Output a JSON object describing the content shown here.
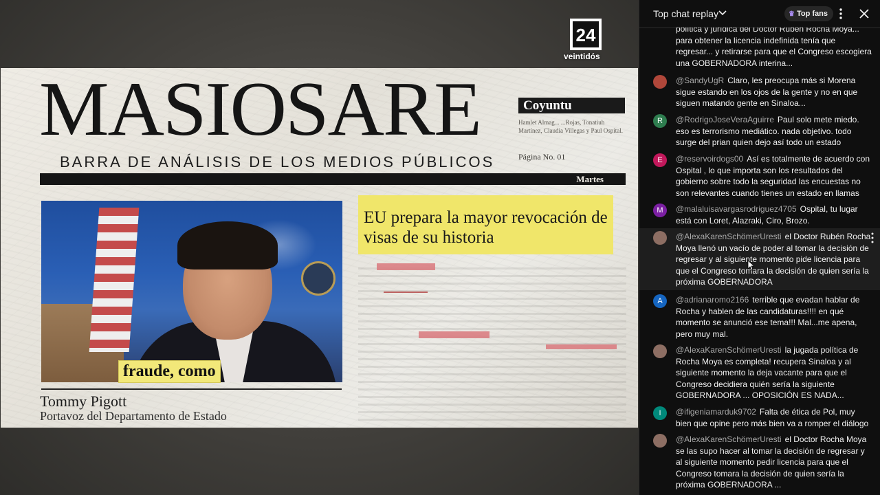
{
  "video": {
    "masthead": "MASIOSARE",
    "subhead": "BARRA DE ANÁLISIS DE LOS MEDIOS PÚBLICOS",
    "section": "Coyuntu",
    "authors": "Hamlet Almag... ...Rojas, Tonatiuh Martínez, Claudia Villegas y Paul Ospital.",
    "page_label": "Página No. 01",
    "day": "Martes",
    "headline": "EU prepara la mayor revocación de visas de su historia",
    "caption": "fraude, como",
    "person_name": "Tommy Pigott",
    "person_role": "Portavoz del Departamento de Estado",
    "brand_number": "24",
    "brand_name": "veintidós"
  },
  "chat": {
    "title": "Top chat replay",
    "top_fans_label": "Top fans",
    "messages": [
      {
        "author": "",
        "text": "política y jurídica del Doctor Rubén Rocha Moya... para obtener la licencia indefinida tenía que regresar... y retirarse para que el Congreso escogiera una GOBERNADORA interina...",
        "avatar_letter": "",
        "avatar_color": ""
      },
      {
        "author": "@SandyUgR",
        "text": "Claro, les preocupa más si Morena sigue estando en los ojos de la gente y no en que siguen matando gente en Sinaloa...",
        "avatar_letter": "",
        "avatar_color": "#b0473a"
      },
      {
        "author": "@RodrigoJoseVeraAguirre",
        "text": "Paul solo mete miedo. eso es terrorismo mediático. nada objetivo. todo surge del prian quien dejo así todo un estado",
        "avatar_letter": "R",
        "avatar_color": "#2e7d4f"
      },
      {
        "author": "@reservoirdogs00",
        "text": "Así es totalmente de acuerdo con Ospital , lo que importa son los resultados del gobierno sobre todo la seguridad las encuestas no son relevantes cuando tienes un estado en llamas",
        "avatar_letter": "E",
        "avatar_color": "#c2185b"
      },
      {
        "author": "@malaluisavargasrodriguez4705",
        "text": "Ospital, tu lugar está con Loret, Alazraki, Ciro, Brozo.",
        "avatar_letter": "M",
        "avatar_color": "#7b1fa2"
      },
      {
        "author": "@AlexaKarenSchömerUresti",
        "text": "el Doctor Rubén Rocha Moya llenó un vacío de poder al tomar la decisión de regresar y al siguiente momento pide licencia para que el Congreso tomara la decisión de quien sería la próxima GOBERNADORA",
        "avatar_letter": "",
        "avatar_color": "#8d6e63"
      },
      {
        "author": "@adrianaromo2166",
        "text": "terrible que evadan hablar de Rocha y hablen de las candidaturas!!!! en qué momento se anunció ese tema!!! Mal...me apena, pero muy mal.",
        "avatar_letter": "A",
        "avatar_color": "#1565c0"
      },
      {
        "author": "@AlexaKarenSchömerUresti",
        "text": "la jugada política de Rocha Moya es completa! recupera Sinaloa y al siguiente momento la deja vacante para que el Congreso decidiera quién sería la siguiente GOBERNADORA ... OPOSICIÓN ES NADA...",
        "avatar_letter": "",
        "avatar_color": "#8d6e63"
      },
      {
        "author": "@ifigeniamarduk9702",
        "text": "Falta de ética de Pol, muy bien que opine pero más bien va a romper el diálogo",
        "avatar_letter": "I",
        "avatar_color": "#00897b"
      },
      {
        "author": "@AlexaKarenSchömerUresti",
        "text": "el Doctor Rocha Moya se las supo hacer al tomar la decisión de regresar y al siguiente momento pedir licencia para que el Congreso tomara la decisión de quien sería la próxima GOBERNADORA ...",
        "avatar_letter": "",
        "avatar_color": "#8d6e63"
      }
    ]
  }
}
